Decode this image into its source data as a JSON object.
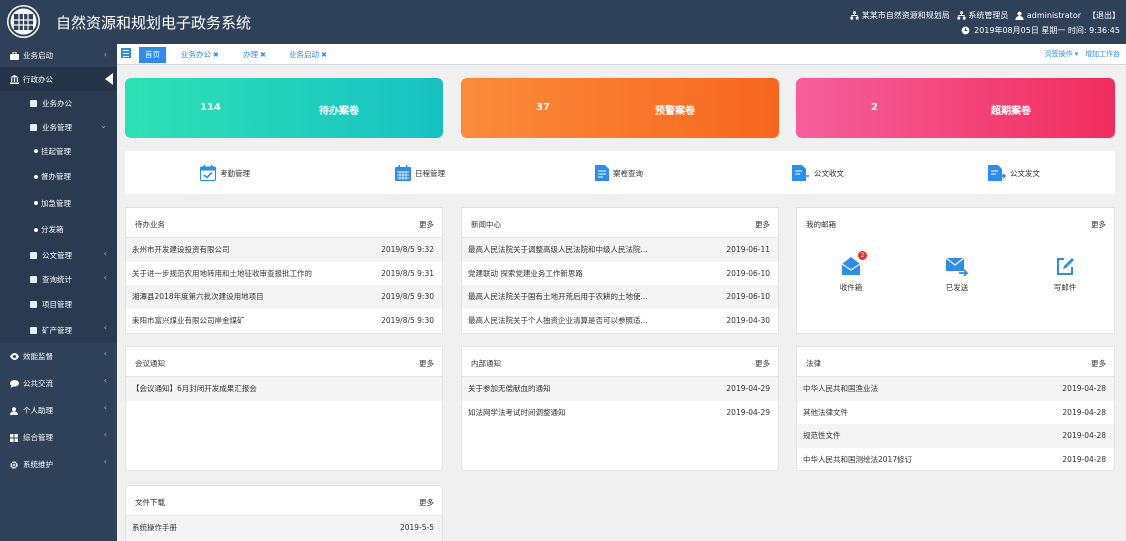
{
  "header": {
    "title": "自然资源和规划电子政务系统",
    "org": "某某市自然资源和规划局",
    "role": "系统管理员",
    "user": "administrator",
    "logout": "【退出】",
    "datetime": "2019年08月05日 星期一 时间: 9:36:45"
  },
  "sidebar": {
    "items": [
      {
        "label": "业务启动",
        "icon": "briefcase-icon"
      },
      {
        "label": "行政办公",
        "icon": "bank-icon"
      },
      {
        "label": "业务办公",
        "icon": "doc-icon"
      },
      {
        "label": "业务管理",
        "icon": "doc-icon"
      },
      {
        "label": "挂起管理"
      },
      {
        "label": "督办管理"
      },
      {
        "label": "加急管理"
      },
      {
        "label": "分发箱"
      },
      {
        "label": "公文管理",
        "icon": "doc-icon"
      },
      {
        "label": "查询统计",
        "icon": "doc-icon"
      },
      {
        "label": "项目管理",
        "icon": "doc-icon"
      },
      {
        "label": "矿产管理",
        "icon": "doc-icon"
      },
      {
        "label": "效能监督",
        "icon": "eye-icon"
      },
      {
        "label": "公共交流",
        "icon": "comment-icon"
      },
      {
        "label": "个人助理",
        "icon": "user-icon"
      },
      {
        "label": "综合管理",
        "icon": "grid-icon"
      },
      {
        "label": "系统维护",
        "icon": "gear-icon"
      }
    ]
  },
  "tabs": {
    "items": [
      {
        "label": "首页"
      },
      {
        "label": "业务办公"
      },
      {
        "label": "办理"
      },
      {
        "label": "业务启动"
      }
    ],
    "close_glyph": "✖",
    "page_actions": "页签操作 ▾",
    "add_workbench": "增加工作台"
  },
  "cards": [
    {
      "count": "114",
      "label": "待办案卷"
    },
    {
      "count": "37",
      "label": "预警案卷"
    },
    {
      "count": "2",
      "label": "超期案卷"
    }
  ],
  "quick": [
    {
      "label": "考勤管理"
    },
    {
      "label": "日程管理"
    },
    {
      "label": "案卷查询"
    },
    {
      "label": "公文收文"
    },
    {
      "label": "公文发文"
    }
  ],
  "more": "更多",
  "todo": {
    "title": "待办业务",
    "rows": [
      {
        "text": "永州市开发建设投资有限公司",
        "date": "2019/8/5 9:32"
      },
      {
        "text": "关于进一步规范农用地转用和土地征收审查报批工作的",
        "date": "2019/8/5 9:31"
      },
      {
        "text": "湘潭县2018年度第六批次建设用地项目",
        "date": "2019/8/5 9:30"
      },
      {
        "text": "耒阳市富兴煤业有限公司岸金煤矿",
        "date": "2019/8/5 9:30"
      }
    ]
  },
  "news": {
    "title": "新闻中心",
    "rows": [
      {
        "text": "最高人民法院关于调整高级人民法院和中级人民法院...",
        "date": "2019-06-11"
      },
      {
        "text": "党建联动 探索党建业务工作新思路",
        "date": "2019-06-10"
      },
      {
        "text": "最高人民法院关于国有土地开荒后用于农耕的土地使...",
        "date": "2019-06-10"
      },
      {
        "text": "最高人民法院关于个人独资企业清算是否可以参照适...",
        "date": "2019-04-30"
      }
    ]
  },
  "mail": {
    "title": "我的邮箱",
    "inbox": "收件箱",
    "inbox_badge": "2",
    "sent": "已发送",
    "compose": "写邮件"
  },
  "meeting": {
    "title": "会议通知",
    "rows": [
      {
        "text": "【会议通知】6月封闭开发成果汇报会",
        "date": ""
      }
    ]
  },
  "internal": {
    "title": "内部通知",
    "rows": [
      {
        "text": "关于参加无偿献血的通知",
        "date": "2019-04-29"
      },
      {
        "text": "如法网学法考试时间调整通知",
        "date": "2019-04-29"
      }
    ]
  },
  "law": {
    "title": "法律",
    "rows": [
      {
        "text": "中华人民共和国渔业法",
        "date": "2019-04-28"
      },
      {
        "text": "其他法律文件",
        "date": "2019-04-28"
      },
      {
        "text": "规范性文件",
        "date": "2019-04-28"
      },
      {
        "text": "中华人民共和国测绘法2017修订",
        "date": "2019-04-28"
      }
    ]
  },
  "download": {
    "title": "文件下载",
    "rows": [
      {
        "text": "系统操作手册",
        "date": "2019-5-5"
      }
    ]
  }
}
